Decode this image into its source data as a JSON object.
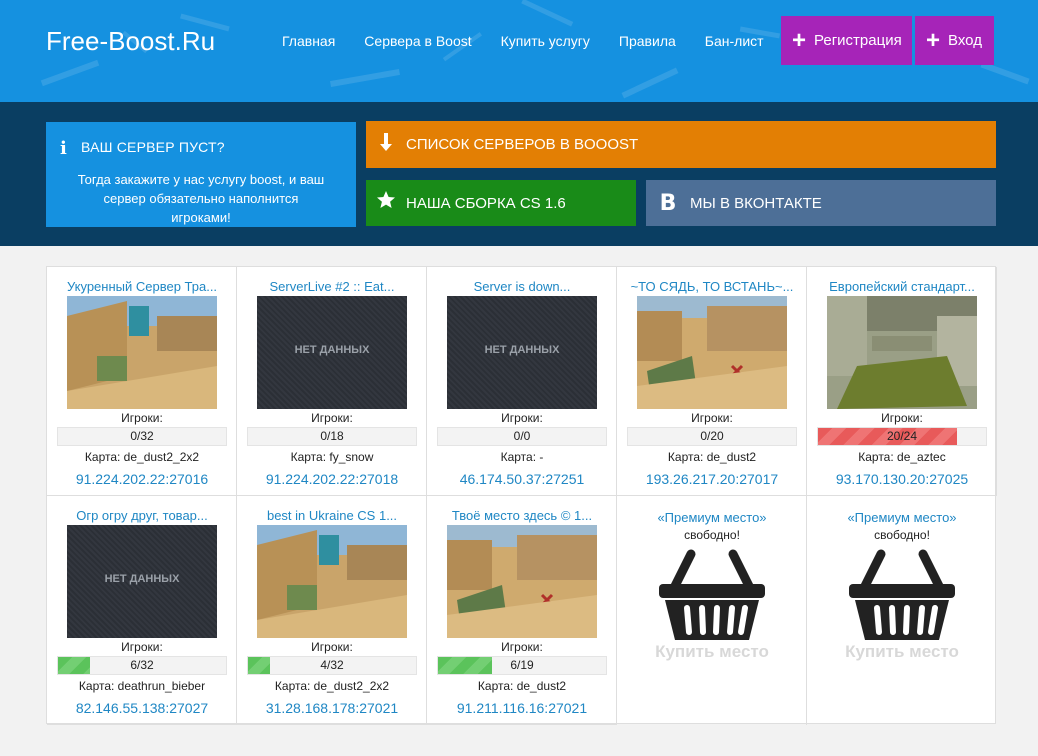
{
  "header": {
    "logo": "Free-Boost.Ru",
    "nav": [
      "Главная",
      "Сервера в Boost",
      "Купить услугу",
      "Правила",
      "Бан-лист"
    ],
    "register_label": "Регистрация",
    "login_label": "Вход"
  },
  "info": {
    "title": "ВАШ СЕРВЕР ПУСТ?",
    "text": "Тогда закажите у нас услугу boost, и ваш сервер обязательно наполнится игроками!"
  },
  "tiles": {
    "list": "СПИСОК СЕРВЕРОВ В BOOOST",
    "build": "НАША СБОРКА CS 1.6",
    "vk": "МЫ В ВКОНТАКТЕ",
    "vk_letter": "B"
  },
  "labels": {
    "players": "Игроки:",
    "no_data": "НЕТ ДАННЫХ",
    "premium_title": "«Премиум место»",
    "premium_free": "свободно!",
    "buy_place": "Купить место"
  },
  "servers": [
    {
      "name": "Укуренный Сервер Тра...",
      "players": "0/32",
      "fill": 0,
      "map": "Карта: de_dust2_2x2",
      "ip": "91.224.202.22:27016",
      "thumb": "dust"
    },
    {
      "name": "ServerLive #2 :: Eat...",
      "players": "0/18",
      "fill": 0,
      "map": "Карта: fy_snow",
      "ip": "91.224.202.22:27018",
      "thumb": "nodata"
    },
    {
      "name": "Server is down...",
      "players": "0/0",
      "fill": 0,
      "map": "Карта: -",
      "ip": "46.174.50.37:27251",
      "thumb": "nodata"
    },
    {
      "name": "~ТО СЯДЬ, ТО ВСТАНЬ~...",
      "players": "0/20",
      "fill": 0,
      "map": "Карта: de_dust2",
      "ip": "193.26.217.20:27017",
      "thumb": "dust2"
    },
    {
      "name": "Европейский стандарт...",
      "players": "20/24",
      "fill": 0.83,
      "map": "Карта: de_aztec",
      "ip": "93.170.130.20:27025",
      "thumb": "aztec",
      "bar": "red"
    },
    {
      "name": "Огр огру друг, товар...",
      "players": "6/32",
      "fill": 0.19,
      "map": "Карта: deathrun_bieber",
      "ip": "82.146.55.138:27027",
      "thumb": "nodata",
      "bar": "green"
    },
    {
      "name": "best in Ukraine CS 1...",
      "players": "4/32",
      "fill": 0.13,
      "map": "Карта: de_dust2_2x2",
      "ip": "31.28.168.178:27021",
      "thumb": "dust",
      "bar": "green"
    },
    {
      "name": "Твоё место здесь © 1...",
      "players": "6/19",
      "fill": 0.32,
      "map": "Карта: de_dust2",
      "ip": "91.211.116.16:27021",
      "thumb": "dust2",
      "bar": "green"
    }
  ],
  "colors": {
    "header_blue": "#1591e0",
    "band": "#0a3e62",
    "orange": "#e37f04",
    "green": "#198b18",
    "vk": "#4d6f97",
    "purple": "#a624b8",
    "link": "#1f87c4"
  }
}
